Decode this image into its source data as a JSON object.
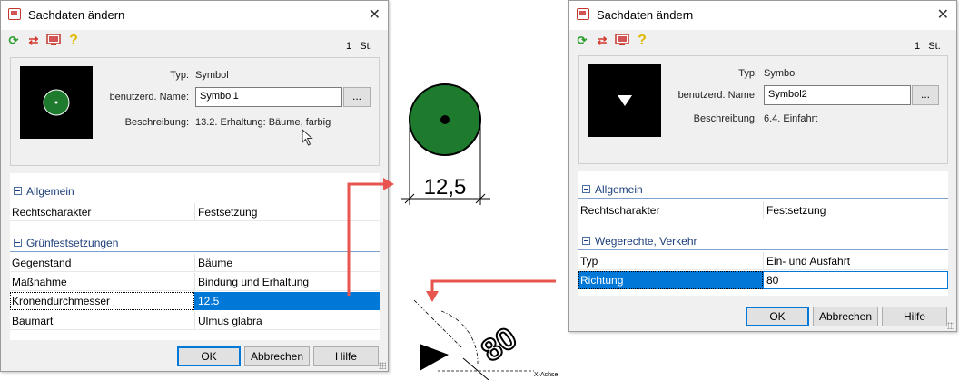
{
  "left_dialog": {
    "title": "Sachdaten ändern",
    "count": "1",
    "count_unit": "St.",
    "fields": {
      "typ_label": "Typ:",
      "typ_value": "Symbol",
      "name_label": "benutzerd. Name:",
      "name_value": "Symbol1",
      "browse_label": "...",
      "desc_label": "Beschreibung:",
      "desc_value": "13.2. Erhaltung: Bäume, farbig"
    },
    "sections": [
      {
        "title": "Allgemein",
        "rows": [
          {
            "key": "Rechtscharakter",
            "value": "Festsetzung"
          }
        ]
      },
      {
        "title": "Grünfestsetzungen",
        "rows": [
          {
            "key": "Gegenstand",
            "value": "Bäume"
          },
          {
            "key": "Maßnahme",
            "value": "Bindung und Erhaltung"
          },
          {
            "key": "Kronendurchmesser",
            "value": "12.5",
            "selected": true
          },
          {
            "key": "Baumart",
            "value": "Ulmus glabra"
          }
        ]
      }
    ],
    "buttons": {
      "ok": "OK",
      "cancel": "Abbrechen",
      "help": "Hilfe"
    }
  },
  "right_dialog": {
    "title": "Sachdaten ändern",
    "count": "1",
    "count_unit": "St.",
    "fields": {
      "typ_label": "Typ:",
      "typ_value": "Symbol",
      "name_label": "benutzerd. Name:",
      "name_value": "Symbol2",
      "browse_label": "...",
      "desc_label": "Beschreibung:",
      "desc_value": "6.4. Einfahrt"
    },
    "sections": [
      {
        "title": "Allgemein",
        "rows": [
          {
            "key": "Rechtscharakter",
            "value": "Festsetzung"
          }
        ]
      },
      {
        "title": "Wegerechte, Verkehr",
        "rows": [
          {
            "key": "Typ",
            "value": "Ein- und Ausfahrt"
          },
          {
            "key": "Richtung",
            "value": "80",
            "selected": true
          }
        ]
      }
    ],
    "buttons": {
      "ok": "OK",
      "cancel": "Abbrechen",
      "help": "Hilfe"
    }
  },
  "illustration": {
    "dimension_label": "12,5",
    "angle_label": "80",
    "axis_label": "X-Achse",
    "tree_color": "#1e7b2e",
    "arrow_color": "#e8554e",
    "selection_color": "#0078d7"
  }
}
